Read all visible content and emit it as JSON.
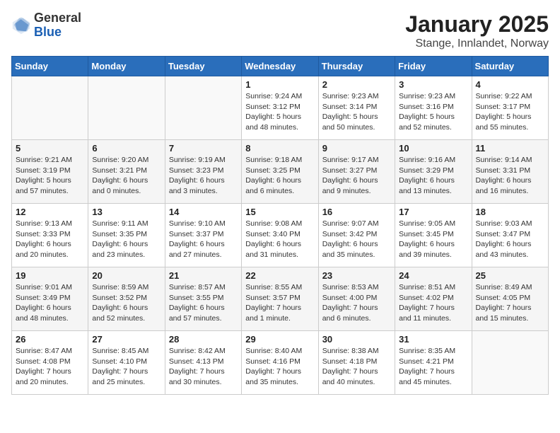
{
  "logo": {
    "general": "General",
    "blue": "Blue"
  },
  "header": {
    "title": "January 2025",
    "subtitle": "Stange, Innlandet, Norway"
  },
  "weekdays": [
    "Sunday",
    "Monday",
    "Tuesday",
    "Wednesday",
    "Thursday",
    "Friday",
    "Saturday"
  ],
  "weeks": [
    [
      {
        "day": "",
        "info": ""
      },
      {
        "day": "",
        "info": ""
      },
      {
        "day": "",
        "info": ""
      },
      {
        "day": "1",
        "info": "Sunrise: 9:24 AM\nSunset: 3:12 PM\nDaylight: 5 hours\nand 48 minutes."
      },
      {
        "day": "2",
        "info": "Sunrise: 9:23 AM\nSunset: 3:14 PM\nDaylight: 5 hours\nand 50 minutes."
      },
      {
        "day": "3",
        "info": "Sunrise: 9:23 AM\nSunset: 3:16 PM\nDaylight: 5 hours\nand 52 minutes."
      },
      {
        "day": "4",
        "info": "Sunrise: 9:22 AM\nSunset: 3:17 PM\nDaylight: 5 hours\nand 55 minutes."
      }
    ],
    [
      {
        "day": "5",
        "info": "Sunrise: 9:21 AM\nSunset: 3:19 PM\nDaylight: 5 hours\nand 57 minutes."
      },
      {
        "day": "6",
        "info": "Sunrise: 9:20 AM\nSunset: 3:21 PM\nDaylight: 6 hours\nand 0 minutes."
      },
      {
        "day": "7",
        "info": "Sunrise: 9:19 AM\nSunset: 3:23 PM\nDaylight: 6 hours\nand 3 minutes."
      },
      {
        "day": "8",
        "info": "Sunrise: 9:18 AM\nSunset: 3:25 PM\nDaylight: 6 hours\nand 6 minutes."
      },
      {
        "day": "9",
        "info": "Sunrise: 9:17 AM\nSunset: 3:27 PM\nDaylight: 6 hours\nand 9 minutes."
      },
      {
        "day": "10",
        "info": "Sunrise: 9:16 AM\nSunset: 3:29 PM\nDaylight: 6 hours\nand 13 minutes."
      },
      {
        "day": "11",
        "info": "Sunrise: 9:14 AM\nSunset: 3:31 PM\nDaylight: 6 hours\nand 16 minutes."
      }
    ],
    [
      {
        "day": "12",
        "info": "Sunrise: 9:13 AM\nSunset: 3:33 PM\nDaylight: 6 hours\nand 20 minutes."
      },
      {
        "day": "13",
        "info": "Sunrise: 9:11 AM\nSunset: 3:35 PM\nDaylight: 6 hours\nand 23 minutes."
      },
      {
        "day": "14",
        "info": "Sunrise: 9:10 AM\nSunset: 3:37 PM\nDaylight: 6 hours\nand 27 minutes."
      },
      {
        "day": "15",
        "info": "Sunrise: 9:08 AM\nSunset: 3:40 PM\nDaylight: 6 hours\nand 31 minutes."
      },
      {
        "day": "16",
        "info": "Sunrise: 9:07 AM\nSunset: 3:42 PM\nDaylight: 6 hours\nand 35 minutes."
      },
      {
        "day": "17",
        "info": "Sunrise: 9:05 AM\nSunset: 3:45 PM\nDaylight: 6 hours\nand 39 minutes."
      },
      {
        "day": "18",
        "info": "Sunrise: 9:03 AM\nSunset: 3:47 PM\nDaylight: 6 hours\nand 43 minutes."
      }
    ],
    [
      {
        "day": "19",
        "info": "Sunrise: 9:01 AM\nSunset: 3:49 PM\nDaylight: 6 hours\nand 48 minutes."
      },
      {
        "day": "20",
        "info": "Sunrise: 8:59 AM\nSunset: 3:52 PM\nDaylight: 6 hours\nand 52 minutes."
      },
      {
        "day": "21",
        "info": "Sunrise: 8:57 AM\nSunset: 3:55 PM\nDaylight: 6 hours\nand 57 minutes."
      },
      {
        "day": "22",
        "info": "Sunrise: 8:55 AM\nSunset: 3:57 PM\nDaylight: 7 hours\nand 1 minute."
      },
      {
        "day": "23",
        "info": "Sunrise: 8:53 AM\nSunset: 4:00 PM\nDaylight: 7 hours\nand 6 minutes."
      },
      {
        "day": "24",
        "info": "Sunrise: 8:51 AM\nSunset: 4:02 PM\nDaylight: 7 hours\nand 11 minutes."
      },
      {
        "day": "25",
        "info": "Sunrise: 8:49 AM\nSunset: 4:05 PM\nDaylight: 7 hours\nand 15 minutes."
      }
    ],
    [
      {
        "day": "26",
        "info": "Sunrise: 8:47 AM\nSunset: 4:08 PM\nDaylight: 7 hours\nand 20 minutes."
      },
      {
        "day": "27",
        "info": "Sunrise: 8:45 AM\nSunset: 4:10 PM\nDaylight: 7 hours\nand 25 minutes."
      },
      {
        "day": "28",
        "info": "Sunrise: 8:42 AM\nSunset: 4:13 PM\nDaylight: 7 hours\nand 30 minutes."
      },
      {
        "day": "29",
        "info": "Sunrise: 8:40 AM\nSunset: 4:16 PM\nDaylight: 7 hours\nand 35 minutes."
      },
      {
        "day": "30",
        "info": "Sunrise: 8:38 AM\nSunset: 4:18 PM\nDaylight: 7 hours\nand 40 minutes."
      },
      {
        "day": "31",
        "info": "Sunrise: 8:35 AM\nSunset: 4:21 PM\nDaylight: 7 hours\nand 45 minutes."
      },
      {
        "day": "",
        "info": ""
      }
    ]
  ]
}
